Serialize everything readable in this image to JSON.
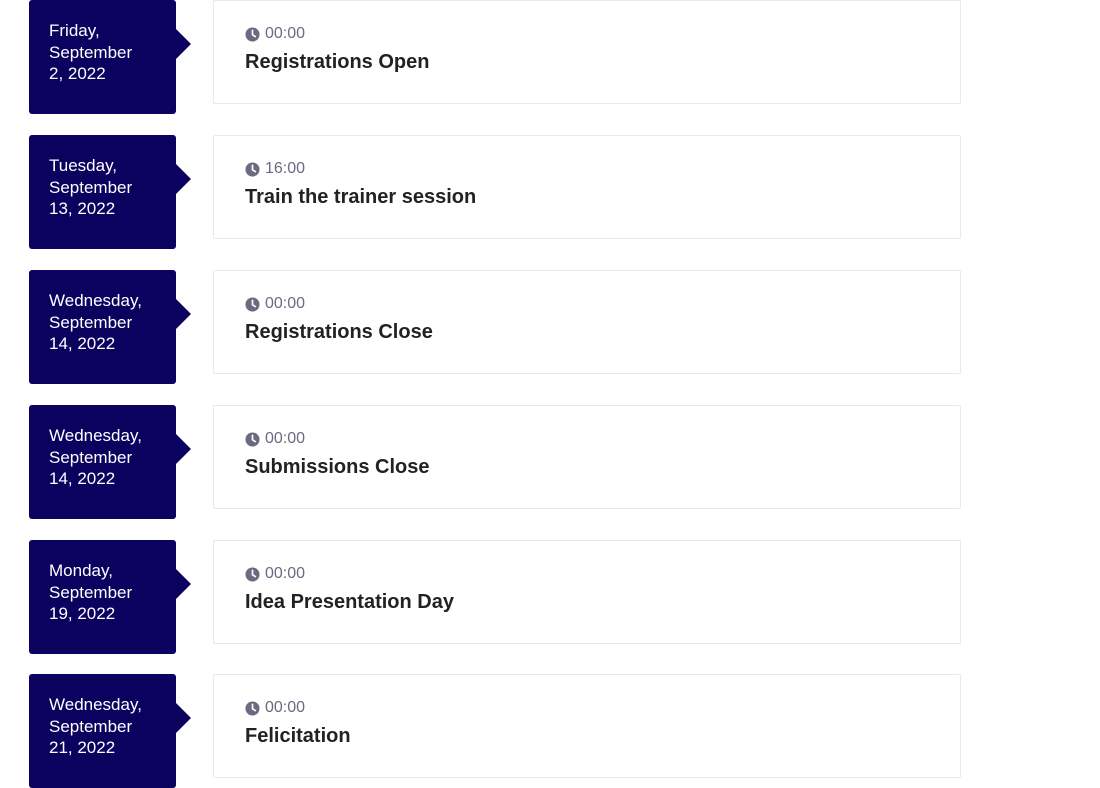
{
  "colors": {
    "date_box_bg": "#0b0260",
    "card_border": "#e8e8ee",
    "time_text": "#6a6a80",
    "title_text": "#222222"
  },
  "events": [
    {
      "date_lines": [
        "Friday,",
        "September",
        "2, 2022"
      ],
      "time": "00:00",
      "title": "Registrations Open",
      "time_icon": "clock-icon"
    },
    {
      "date_lines": [
        "Tuesday,",
        "September",
        "13, 2022"
      ],
      "time": "16:00",
      "title": "Train the trainer session",
      "time_icon": "clock-icon"
    },
    {
      "date_lines": [
        "Wednesday,",
        "September",
        "14, 2022"
      ],
      "time": "00:00",
      "title": "Registrations Close",
      "time_icon": "clock-icon"
    },
    {
      "date_lines": [
        "Wednesday,",
        "September",
        "14, 2022"
      ],
      "time": "00:00",
      "title": "Submissions Close",
      "time_icon": "clock-icon"
    },
    {
      "date_lines": [
        "Monday,",
        "September",
        "19, 2022"
      ],
      "time": "00:00",
      "title": "Idea Presentation Day",
      "time_icon": "clock-icon"
    },
    {
      "date_lines": [
        "Wednesday,",
        "September",
        "21, 2022"
      ],
      "time": "00:00",
      "title": "Felicitation",
      "time_icon": "clock-icon"
    }
  ]
}
